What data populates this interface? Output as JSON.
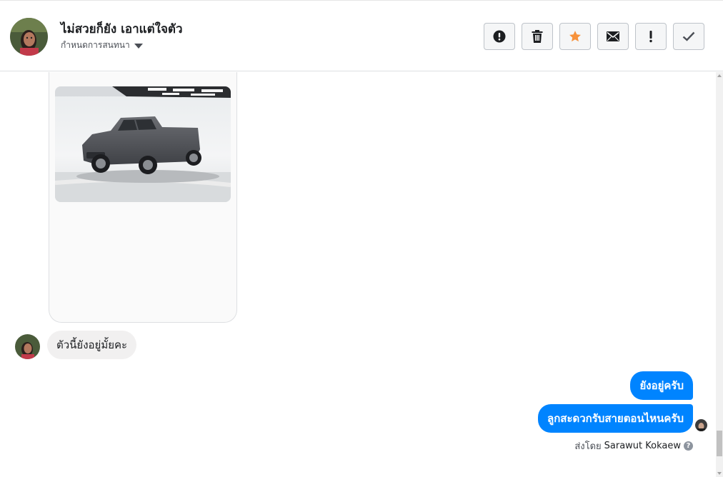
{
  "header": {
    "title": "ไม่สวยก็ยัง เอาแต่ใจตัว",
    "subtitle": "กำหนดการสนทนา",
    "toolbar": [
      {
        "name": "report-button",
        "icon": "alert-circle-icon"
      },
      {
        "name": "delete-button",
        "icon": "trash-icon"
      },
      {
        "name": "star-button",
        "icon": "star-icon"
      },
      {
        "name": "mark-unread-button",
        "icon": "envelope-icon"
      },
      {
        "name": "mark-spam-button",
        "icon": "exclamation-icon"
      },
      {
        "name": "mark-done-button",
        "icon": "checkmark-icon"
      }
    ]
  },
  "conversation": {
    "attachment": {
      "type": "image",
      "depicts": "grey pickup truck in white studio",
      "icon": "car-photo"
    },
    "incoming": [
      {
        "text": "ตัวนี้ยังอยู่มั้ยคะ"
      }
    ],
    "outgoing": [
      {
        "text": "ยังอยู่ครับ"
      },
      {
        "text": "ลูกสะดวกรับสายตอนไหนครับ"
      }
    ],
    "sent_by_label": "ส่งโดย",
    "sent_by_name": "Sarawut Kokaew",
    "help_glyph": "?"
  },
  "colors": {
    "accent": "#0084ff",
    "star": "#f7923b",
    "incoming_bubble": "#f1f0f0"
  }
}
